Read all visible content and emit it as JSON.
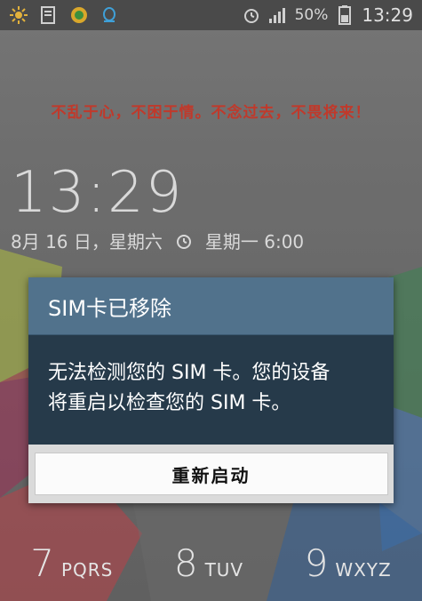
{
  "status_bar": {
    "icons_left": [
      "weather-sun-icon",
      "note-icon",
      "app-circle-icon",
      "qq-icon"
    ],
    "battery_percent": "50%",
    "time": "13:29"
  },
  "lock_screen": {
    "motto": "不乱于心，不困于情。不念过去，不畏将来！",
    "time": "13:29",
    "date": "8月 16 日，星期六",
    "alarm": "星期一 6:00"
  },
  "dialog": {
    "title": "SIM卡已移除",
    "message_line1": "无法检测您的 SIM 卡。您的设备",
    "message_line2": "将重启以检查您的 SIM 卡。",
    "button_label": "重新启动"
  },
  "keypad": [
    {
      "digit": "7",
      "letters": "PQRS"
    },
    {
      "digit": "8",
      "letters": "TUV"
    },
    {
      "digit": "9",
      "letters": "WXYZ"
    }
  ],
  "colors": {
    "dialog_header": "#51728c",
    "dialog_body": "#263a4a",
    "motto_red": "#c0392b"
  }
}
